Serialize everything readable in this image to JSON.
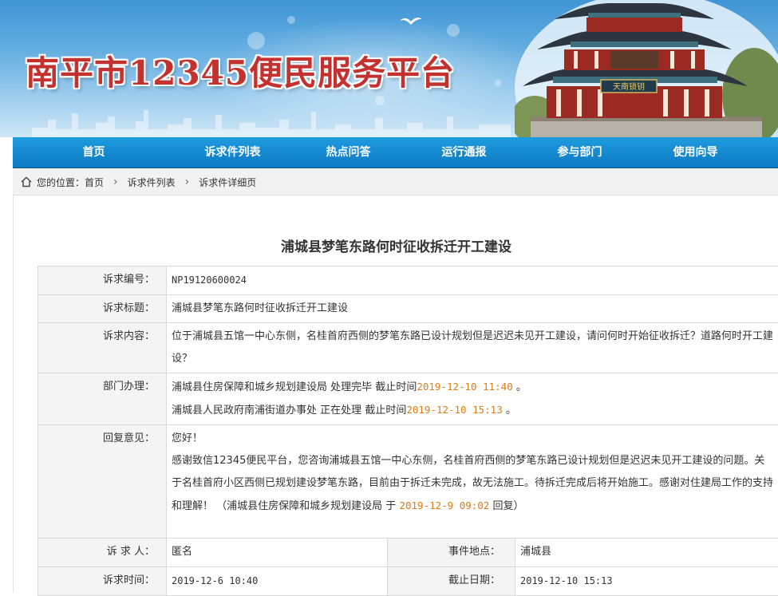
{
  "header": {
    "site_title": "南平市12345便民服务平台",
    "plaque_text": "天南锁钥"
  },
  "nav": {
    "items": [
      {
        "label": "首页"
      },
      {
        "label": "诉求件列表"
      },
      {
        "label": "热点问答"
      },
      {
        "label": "运行通报"
      },
      {
        "label": "参与部门"
      },
      {
        "label": "使用向导"
      }
    ]
  },
  "breadcrumb": {
    "prefix": "您的位置：",
    "items": [
      "首页",
      "诉求件列表",
      "诉求件详细页"
    ]
  },
  "page": {
    "title": "浦城县梦笔东路何时征收拆迁开工建设"
  },
  "detail": {
    "number_label": "诉求编号：",
    "number": "NP19120600024",
    "title_label": "诉求标题：",
    "title": "浦城县梦笔东路何时征收拆迁开工建设",
    "content_label": "诉求内容：",
    "content": "位于浦城县五馆一中心东侧，名桂首府西侧的梦笔东路已设计规划但是迟迟未见开工建设，请问何时开始征收拆迁？道路何时开工建设？",
    "dept_label": "部门办理：",
    "departments": [
      {
        "name": "浦城县住房保障和城乡规划建设局",
        "status": "处理完毕",
        "deadline_label": "截止时间",
        "deadline": "2019-12-10 11:40",
        "end": "。"
      },
      {
        "name": "浦城县人民政府南浦街道办事处",
        "status": "正在处理",
        "deadline_label": "截止时间",
        "deadline": "2019-12-10 15:13",
        "end": "。"
      }
    ],
    "reply_label": "回复意见：",
    "reply_greeting": "您好！",
    "reply_body": "感谢致信12345便民平台，您咨询浦城县五馆一中心东侧，名桂首府西侧的梦笔东路已设计规划但是迟迟未见开工建设的问题。关于名桂首府小区西侧已规划建设梦笔东路，目前由于拆迁未完成，故无法施工。待拆迁完成后将开始施工。感谢对住建局工作的支持和理解！",
    "reply_sign_prefix": "（浦城县住房保障和城乡规划建设局 于",
    "reply_time": "2019-12-9 09:02",
    "reply_sign_suffix": "回复）",
    "requester_label": "诉 求 人：",
    "requester": "匿名",
    "location_label": "事件地点：",
    "location": "浦城县",
    "time_label": "诉求时间：",
    "time": "2019-12-6 10:40",
    "deadline_label": "截止日期：",
    "deadline": "2019-12-10 15:13"
  },
  "colors": {
    "title_red": "#c3322f",
    "nav_blue": "#0d79c2",
    "time_orange": "#e07b16"
  }
}
